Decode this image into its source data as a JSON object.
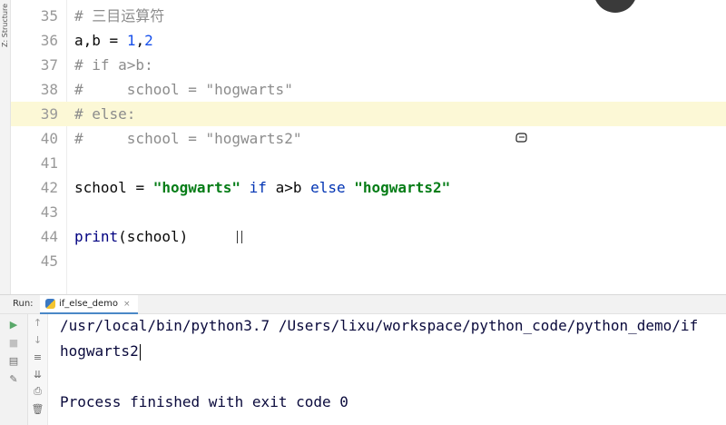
{
  "editor": {
    "structure_label": "Z: Structure",
    "current_line": 39,
    "lines": [
      {
        "number": "35",
        "tokens": [
          {
            "t": "# 三目运算符",
            "c": "comment"
          }
        ]
      },
      {
        "number": "36",
        "tokens": [
          {
            "t": "a",
            "c": "op"
          },
          {
            "t": ",",
            "c": "op"
          },
          {
            "t": "b ",
            "c": "op"
          },
          {
            "t": "= ",
            "c": "op"
          },
          {
            "t": "1",
            "c": "number"
          },
          {
            "t": ",",
            "c": "op"
          },
          {
            "t": "2",
            "c": "number"
          }
        ]
      },
      {
        "number": "37",
        "tokens": [
          {
            "t": "# if a>b:",
            "c": "comment"
          }
        ]
      },
      {
        "number": "38",
        "tokens": [
          {
            "t": "#     school = \"hogwarts\"",
            "c": "comment"
          }
        ]
      },
      {
        "number": "39",
        "tokens": [
          {
            "t": "# else:",
            "c": "comment"
          }
        ]
      },
      {
        "number": "40",
        "tokens": [
          {
            "t": "#     school = \"hogwarts2\"",
            "c": "comment"
          }
        ]
      },
      {
        "number": "41",
        "tokens": []
      },
      {
        "number": "42",
        "tokens": [
          {
            "t": "school ",
            "c": "op"
          },
          {
            "t": "= ",
            "c": "op"
          },
          {
            "t": "\"hogwarts\"",
            "c": "string"
          },
          {
            "t": " if ",
            "c": "keyword"
          },
          {
            "t": "a>b",
            "c": "op"
          },
          {
            "t": " else ",
            "c": "keyword"
          },
          {
            "t": "\"hogwarts2\"",
            "c": "string"
          }
        ]
      },
      {
        "number": "43",
        "tokens": []
      },
      {
        "number": "44",
        "tokens": [
          {
            "t": "print",
            "c": "builtin"
          },
          {
            "t": "(school)",
            "c": "op"
          }
        ]
      },
      {
        "number": "45",
        "tokens": []
      }
    ]
  },
  "run_window": {
    "label": "Run:",
    "tab_label": "if_else_demo",
    "tab_close": "×",
    "toolbar_left": [
      {
        "name": "rerun-icon",
        "glyph": "▶",
        "color": "#59a869"
      },
      {
        "name": "stop-icon",
        "glyph": "■",
        "color": "#c0c0c0"
      },
      {
        "name": "layout-icon",
        "glyph": "▤",
        "color": "#6e6e6e"
      },
      {
        "name": "pin-icon",
        "glyph": "✎",
        "color": "#6e6e6e"
      }
    ],
    "toolbar_right": [
      {
        "name": "scroll-up-icon",
        "glyph": "↑",
        "color": "#9a9a9a"
      },
      {
        "name": "scroll-down-icon",
        "glyph": "↓",
        "color": "#9a9a9a"
      },
      {
        "name": "soft-wrap-icon",
        "glyph": "≡",
        "color": "#6e6e6e"
      },
      {
        "name": "scroll-to-end-icon",
        "glyph": "⇊",
        "color": "#6e6e6e"
      },
      {
        "name": "print-icon",
        "glyph": "⎙",
        "color": "#6e6e6e"
      },
      {
        "name": "trash-icon",
        "glyph": "🗑",
        "color": "#6e6e6e"
      }
    ],
    "console_lines": [
      "/usr/local/bin/python3.7 /Users/lixu/workspace/python_code/python_demo/if",
      "hogwarts2",
      "",
      "Process finished with exit code 0"
    ]
  },
  "colors": {
    "comment": "#8c8c8c",
    "string": "#067d17",
    "keyword": "#0033b3",
    "number": "#1750eb",
    "current_line_bg": "#fcf8d6"
  }
}
